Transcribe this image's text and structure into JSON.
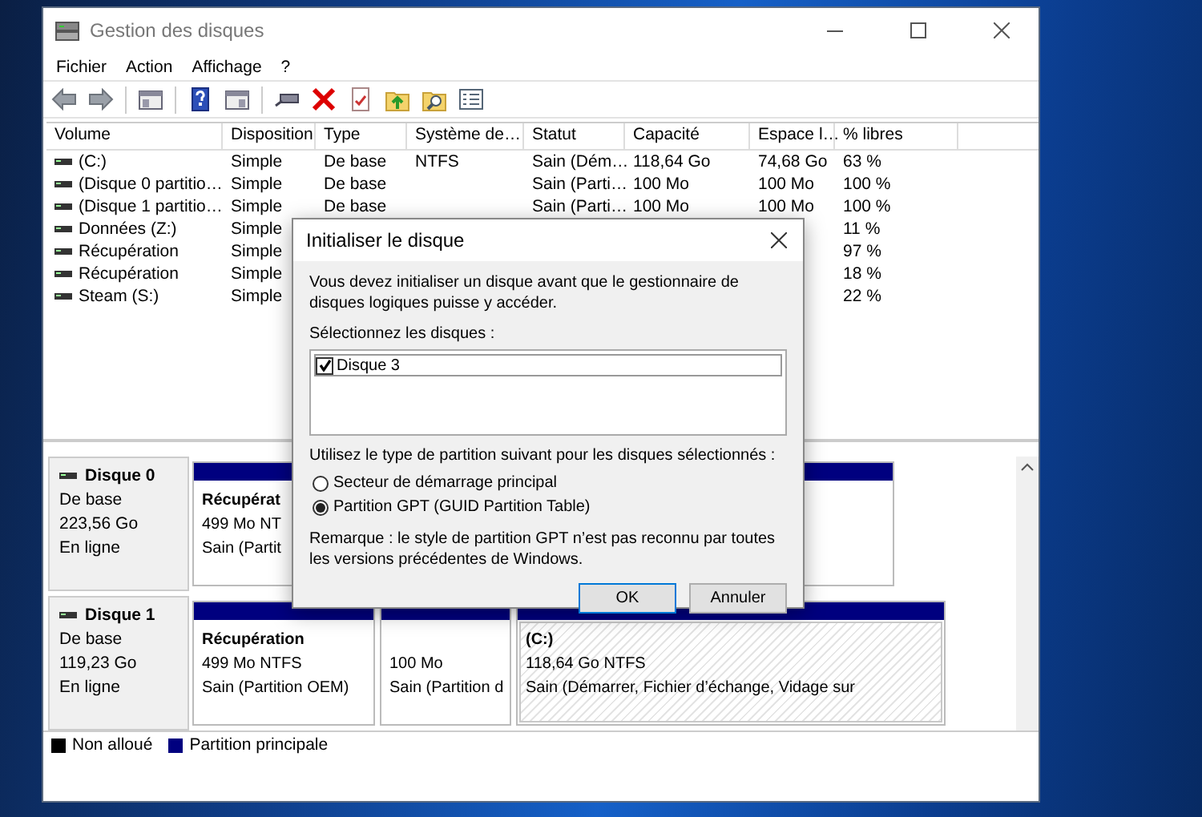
{
  "window": {
    "title": "Gestion des disques"
  },
  "menu": [
    "Fichier",
    "Action",
    "Affichage",
    "?"
  ],
  "volumes": {
    "columns": [
      "Volume",
      "Disposition",
      "Type",
      "Système de…",
      "Statut",
      "Capacité",
      "Espace l…",
      "% libres"
    ],
    "rows": [
      {
        "cells": [
          "(C:)",
          "Simple",
          "De base",
          "NTFS",
          "Sain (Dém…",
          "118,64 Go",
          "74,68 Go",
          "63 %"
        ]
      },
      {
        "cells": [
          "(Disque 0 partitio…",
          "Simple",
          "De base",
          null,
          "Sain (Parti…",
          "100 Mo",
          "100 Mo",
          "100 %"
        ]
      },
      {
        "cells": [
          "(Disque 1 partitio…",
          "Simple",
          "De base",
          null,
          "Sain (Parti…",
          "100 Mo",
          "100 Mo",
          "100 %"
        ]
      },
      {
        "cells": [
          "Données (Z:)",
          "Simple",
          null,
          null,
          null,
          null,
          null,
          "11 %"
        ]
      },
      {
        "cells": [
          "Récupération",
          "Simple",
          null,
          null,
          null,
          null,
          null,
          "97 %"
        ]
      },
      {
        "cells": [
          "Récupération",
          "Simple",
          null,
          null,
          null,
          null,
          null,
          "18 %"
        ]
      },
      {
        "cells": [
          "Steam (S:)",
          "Simple",
          null,
          null,
          null,
          null,
          null,
          "22 %"
        ]
      }
    ]
  },
  "disks": [
    {
      "name": "Disque 0",
      "type": "De base",
      "size": "223,56 Go",
      "state": "En ligne",
      "partitions": [
        {
          "kind": "primary",
          "selected": false,
          "name": "Récupérat",
          "size": "499 Mo NT",
          "status": "Sain (Partit"
        },
        {
          "kind": "primary",
          "selected": false
        }
      ]
    },
    {
      "name": "Disque 1",
      "type": "De base",
      "size": "119,23 Go",
      "state": "En ligne",
      "partitions": [
        {
          "kind": "primary",
          "selected": false,
          "name": "Récupération",
          "size": "499 Mo NTFS",
          "status": "Sain (Partition OEM)"
        },
        {
          "kind": "primary",
          "selected": false,
          "size": "100 Mo",
          "status": "Sain (Partition d"
        },
        {
          "kind": "primary",
          "selected": true,
          "name": "(C:)",
          "size": "118,64 Go NTFS",
          "status": "Sain (Démarrer, Fichier d’échange, Vidage sur"
        }
      ]
    }
  ],
  "legend": [
    {
      "kind": "unallocated",
      "label": "Non alloué",
      "color": "#000000"
    },
    {
      "kind": "primary",
      "label": "Partition principale",
      "color": "#00007f"
    }
  ],
  "dialog": {
    "title": "Initialiser le disque",
    "message": "Vous devez initialiser un disque avant que le gestionnaire de disques logiques puisse y accéder.",
    "disks_label": "Sélectionnez les disques :",
    "disks": [
      {
        "label": "Disque 3",
        "checked": true
      }
    ],
    "style_label": "Utilisez le type de partition suivant pour les disques sélectionnés :",
    "partition_styles": [
      {
        "label": "Secteur de démarrage principal",
        "selected": false
      },
      {
        "label": "Partition GPT (GUID Partition Table)",
        "selected": true
      }
    ],
    "note": "Remarque : le style de partition GPT n’est pas reconnu par toutes les versions précédentes de Windows.",
    "buttons": [
      {
        "label": "OK",
        "default": true
      },
      {
        "label": "Annuler",
        "default": false
      }
    ]
  }
}
